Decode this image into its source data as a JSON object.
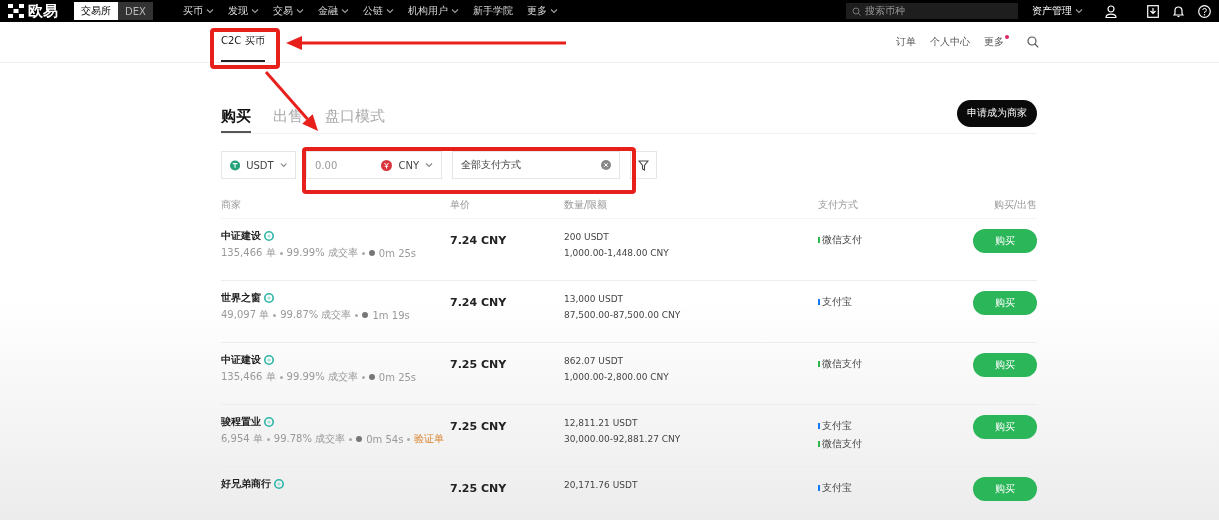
{
  "top_bar": {
    "logo": "欧易",
    "mode_tabs": [
      {
        "label": "交易所",
        "selected": true
      },
      {
        "label": "DEX",
        "selected": false
      }
    ],
    "menu": [
      {
        "label": "买币",
        "dropdown": true
      },
      {
        "label": "发现",
        "dropdown": true
      },
      {
        "label": "交易",
        "dropdown": true
      },
      {
        "label": "金融",
        "dropdown": true
      },
      {
        "label": "公链",
        "dropdown": true
      },
      {
        "label": "机构用户",
        "dropdown": true
      },
      {
        "label": "新手学院",
        "dropdown": false
      },
      {
        "label": "更多",
        "dropdown": true
      }
    ],
    "search": {
      "placeholder": "搜索币种"
    },
    "assets": "资产管理"
  },
  "sub_nav": {
    "items": [
      {
        "label": "C2C 买币",
        "selected": true
      }
    ],
    "links": [
      {
        "label": "订单",
        "notification": false
      },
      {
        "label": "个人中心",
        "notification": false
      },
      {
        "label": "更多",
        "notification": true
      }
    ]
  },
  "trade_tabs": [
    {
      "label": "购买",
      "selected": true
    },
    {
      "label": "出售",
      "selected": false
    },
    {
      "label": "盘口模式",
      "selected": false
    }
  ],
  "apply_button": "申请成为商家",
  "filters": {
    "crypto": "USDT",
    "amount": {
      "placeholder": "0.00"
    },
    "fiat": "CNY",
    "payment": {
      "value": "全部支付方式"
    }
  },
  "table": {
    "columns": [
      "商家",
      "单价",
      "数量/限额",
      "支付方式",
      "购买/出售"
    ],
    "rows": [
      {
        "merchant": "中证建设",
        "verified": true,
        "orders": "135,466 单",
        "completion": "99.99% 成交率",
        "time": "0m 25s",
        "price": "7.24 CNY",
        "amount": "200 USDT",
        "limit": "1,000.00-1,448.00 CNY",
        "payments": [
          {
            "name": "微信支付",
            "color": "#2db84d"
          }
        ],
        "action": "购买"
      },
      {
        "merchant": "世界之窗",
        "verified": true,
        "orders": "49,097 单",
        "completion": "99.87% 成交率",
        "time": "1m 19s",
        "price": "7.24 CNY",
        "amount": "13,000 USDT",
        "limit": "87,500.00-87,500.00 CNY",
        "payments": [
          {
            "name": "支付宝",
            "color": "#1677ff"
          }
        ],
        "action": "购买"
      },
      {
        "merchant": "中证建设",
        "verified": true,
        "orders": "135,466 单",
        "completion": "99.99% 成交率",
        "time": "0m 25s",
        "price": "7.25 CNY",
        "amount": "862.07 USDT",
        "limit": "1,000.00-2,800.00 CNY",
        "payments": [
          {
            "name": "微信支付",
            "color": "#2db84d"
          }
        ],
        "action": "购买"
      },
      {
        "merchant": "骏程置业",
        "verified": true,
        "orders": "6,954 单",
        "completion": "99.78% 成交率",
        "time": "0m 54s",
        "tag": "验证单",
        "price": "7.25 CNY",
        "amount": "12,811.21 USDT",
        "limit": "30,000.00-92,881.27 CNY",
        "payments": [
          {
            "name": "支付宝",
            "color": "#1677ff"
          },
          {
            "name": "微信支付",
            "color": "#2db84d"
          }
        ],
        "action": "购买"
      },
      {
        "merchant": "好兄弟商行",
        "verified": true,
        "price": "7.25 CNY",
        "amount": "20,171.76 USDT",
        "payments": [
          {
            "name": "支付宝",
            "color": "#1677ff"
          }
        ],
        "action": "购买"
      }
    ]
  },
  "annotations": [
    {
      "kind": "box"
    },
    {
      "kind": "box"
    },
    {
      "kind": "arrow"
    },
    {
      "kind": "arrow"
    }
  ]
}
